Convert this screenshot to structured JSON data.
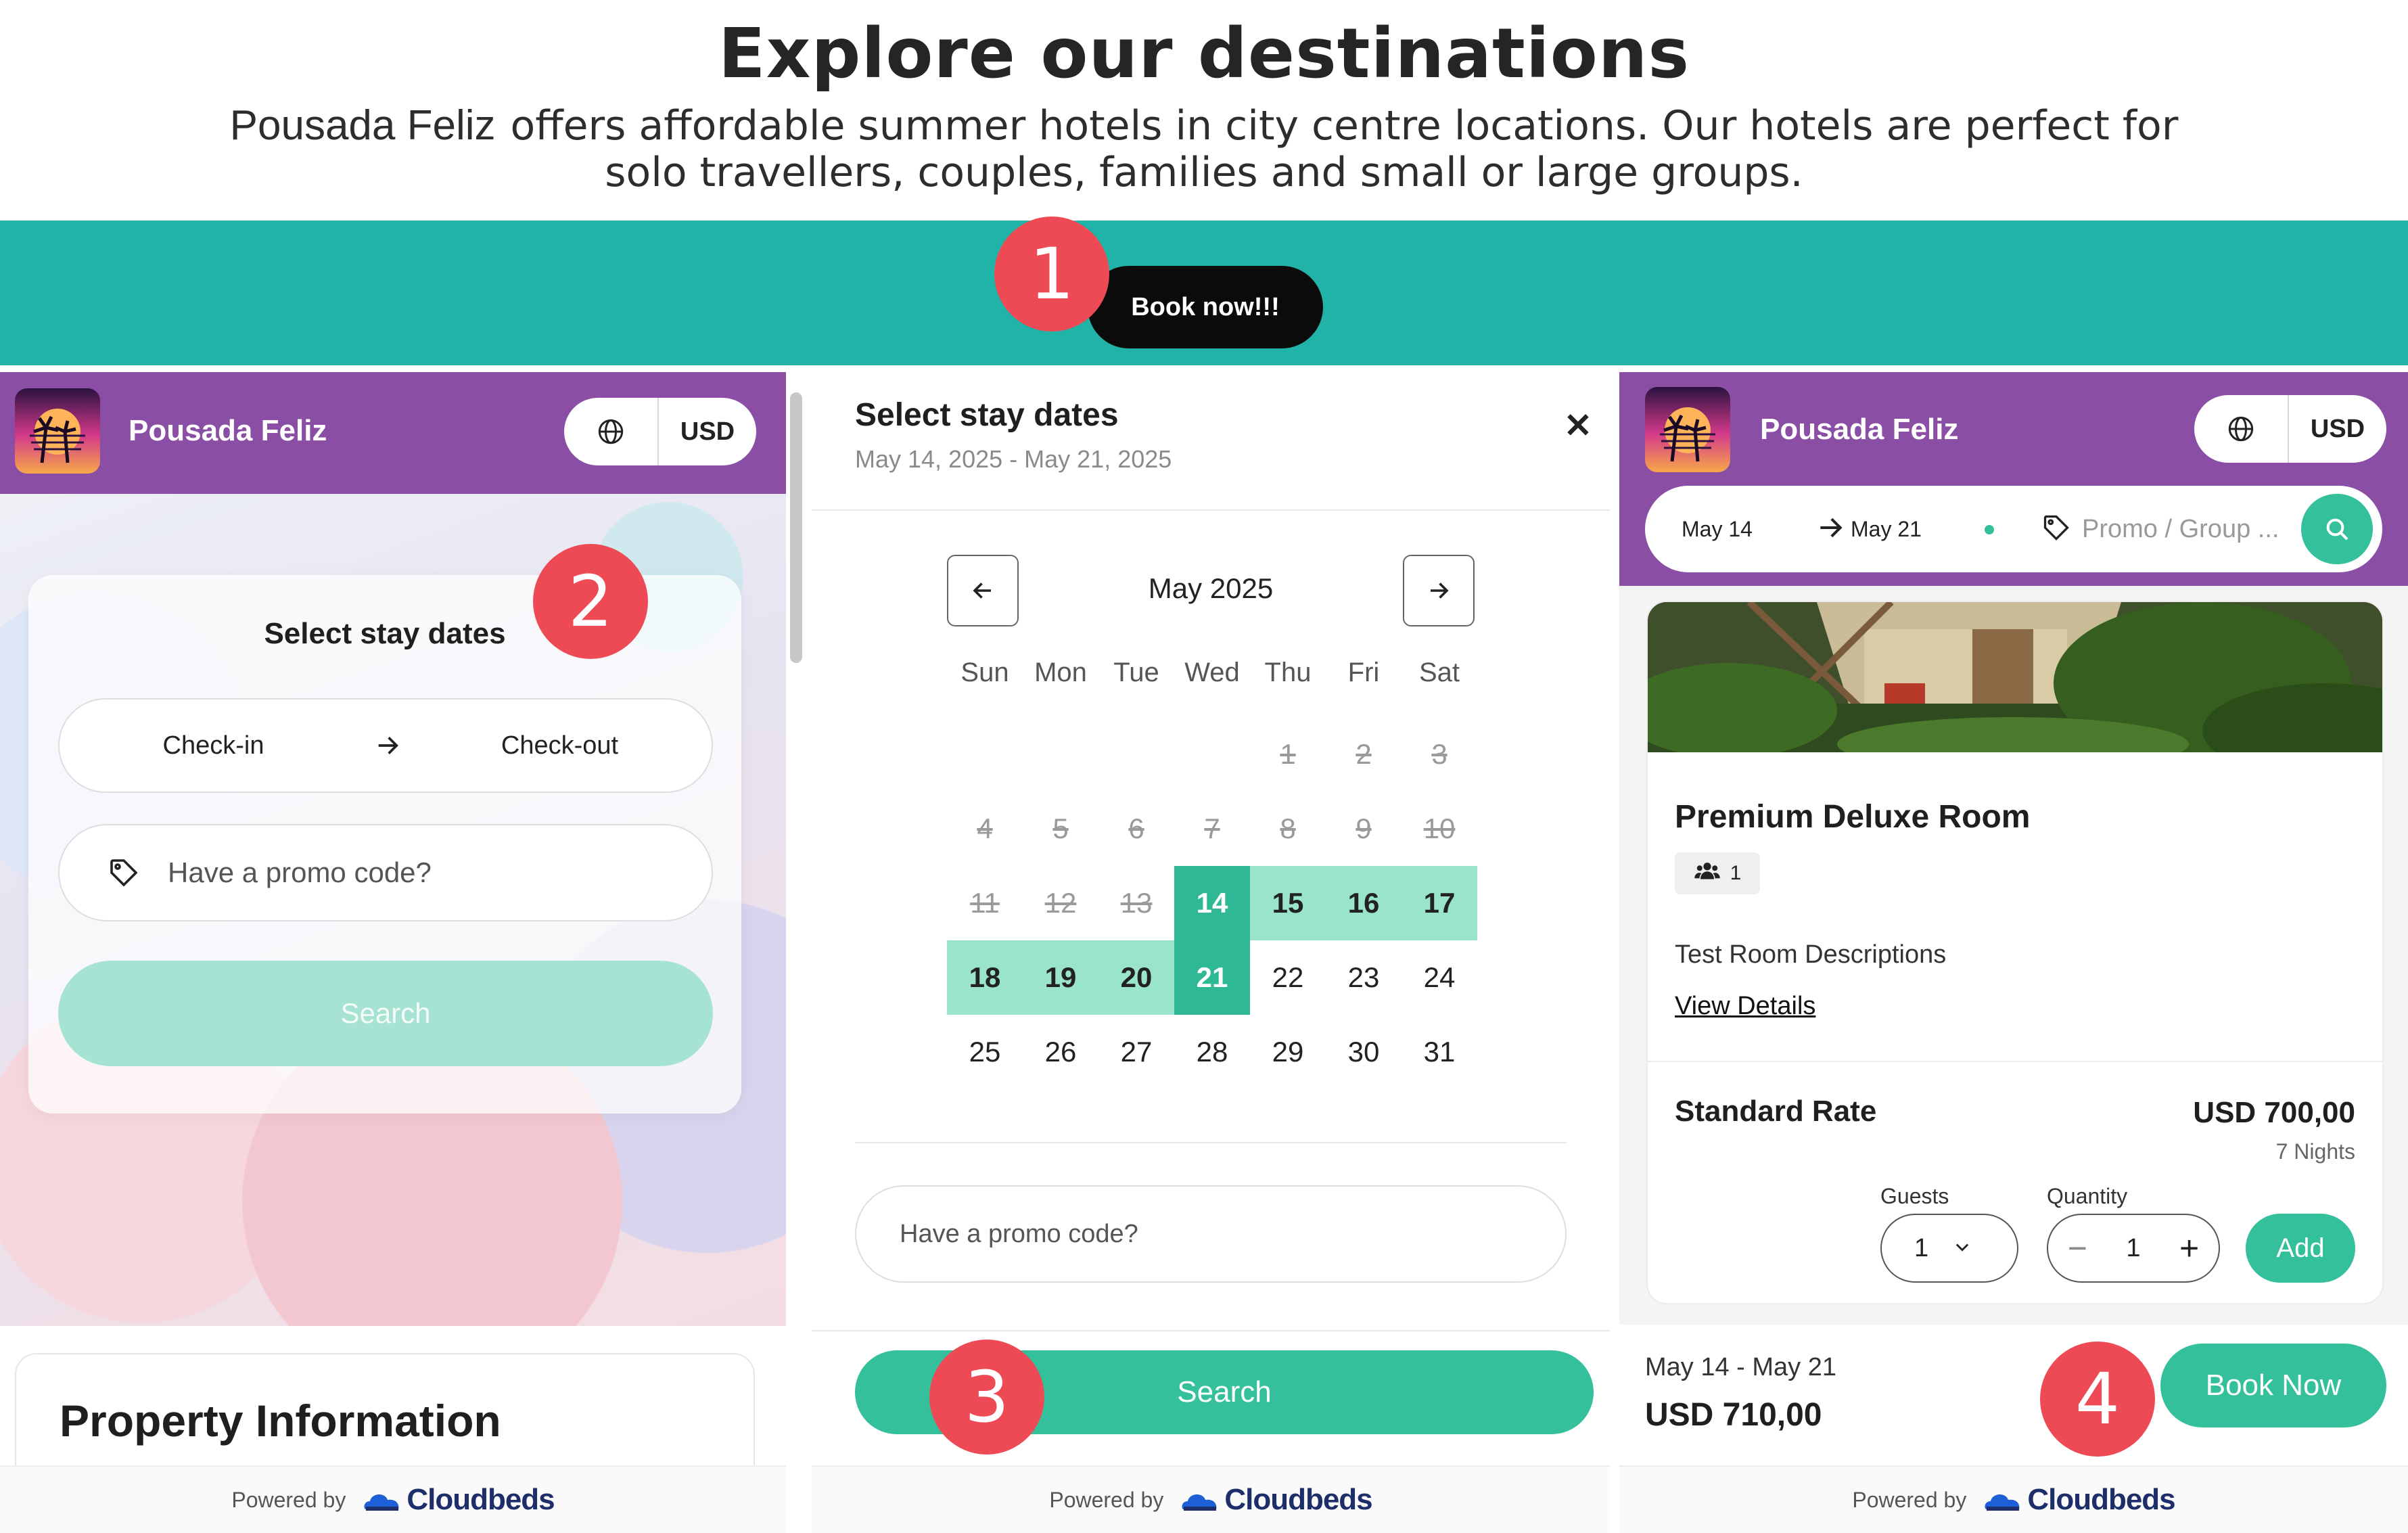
{
  "hero": {
    "title": "Explore our destinations",
    "brand": "Pousada Feliz",
    "line1": "offers affordable summer hotels in city centre locations. Our hotels are perfect for",
    "line2": "solo travellers, couples, families and small or large groups.",
    "book_label": "Book now!!!",
    "banner_color": "#22b3a8"
  },
  "markers": [
    "1",
    "2",
    "3",
    "4"
  ],
  "theme": {
    "header": "#8a4fa5",
    "accent": "#33c09b",
    "range": "#9ae3cd",
    "marker": "#ee4a55"
  },
  "panel1": {
    "property_name": "Pousada Feliz",
    "currency": "USD",
    "card_title": "Select stay dates",
    "checkin_label": "Check-in",
    "checkout_label": "Check-out",
    "promo_placeholder": "Have a promo code?",
    "search_label": "Search",
    "section_title": "Property Information"
  },
  "panel2": {
    "title": "Select stay dates",
    "subtitle": "May 14, 2025 - May 21, 2025",
    "month": "May 2025",
    "weekdays": [
      "Sun",
      "Mon",
      "Tue",
      "Wed",
      "Thu",
      "Fri",
      "Sat"
    ],
    "first_weekday_index": 4,
    "days_in_month": 31,
    "disabled_through": 13,
    "check_in": 14,
    "check_out": 21,
    "promo_placeholder": "Have a promo code?",
    "search_label": "Search"
  },
  "panel3": {
    "property_name": "Pousada Feliz",
    "currency": "USD",
    "check_in": "May 14",
    "check_out": "May 21",
    "promo_placeholder": "Promo / Group ...",
    "room_title": "Premium Deluxe Room",
    "occupancy": "1",
    "room_description": "Test Room Descriptions",
    "view_details": "View Details",
    "rate_name": "Standard Rate",
    "rate_price": "USD 700,00",
    "nights": "7 Nights",
    "guests_label": "Guests",
    "guests_value": "1",
    "quantity_label": "Quantity",
    "quantity_value": "1",
    "add_label": "Add",
    "footer_dates": "May 14 - May 21",
    "footer_total": "USD 710,00",
    "book_now_label": "Book Now"
  },
  "footer": {
    "powered_by": "Powered by",
    "brand": "Cloudbeds"
  }
}
